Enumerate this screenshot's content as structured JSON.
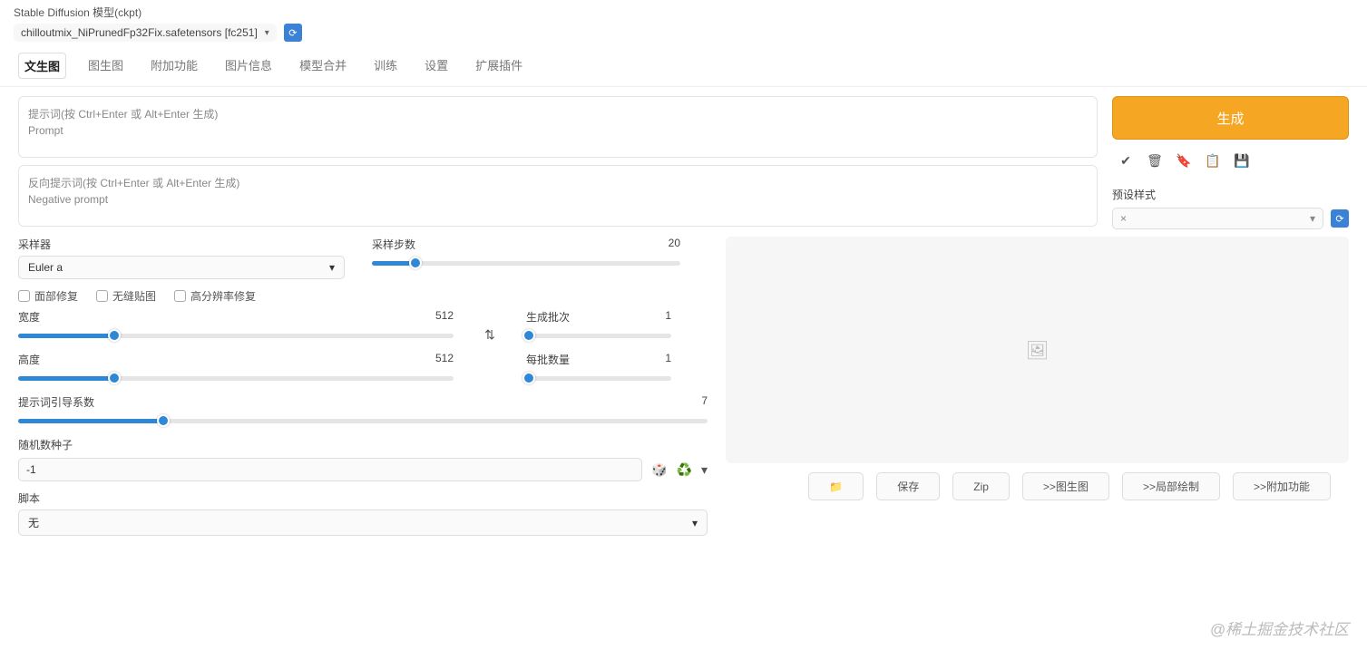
{
  "header": {
    "title": "Stable Diffusion 模型(ckpt)",
    "model": "chilloutmix_NiPrunedFp32Fix.safetensors [fc251]"
  },
  "tabs": [
    "文生图",
    "图生图",
    "附加功能",
    "图片信息",
    "模型合并",
    "训练",
    "设置",
    "扩展插件"
  ],
  "prompt": {
    "pos_placeholder": "提示词(按 Ctrl+Enter 或 Alt+Enter 生成)\nPrompt",
    "neg_placeholder": "反向提示词(按 Ctrl+Enter 或 Alt+Enter 生成)\nNegative prompt"
  },
  "gen": {
    "label": "生成"
  },
  "style": {
    "label": "预设样式",
    "placeholder": "×"
  },
  "sampler": {
    "method_label": "采样器",
    "method_value": "Euler a",
    "steps_label": "采样步数",
    "steps_value": "20"
  },
  "checks": {
    "face": "面部修复",
    "tile": "无缝贴图",
    "hires": "高分辨率修复"
  },
  "dims": {
    "width_label": "宽度",
    "width_value": "512",
    "height_label": "高度",
    "height_value": "512",
    "batch_count_label": "生成批次",
    "batch_count_value": "1",
    "batch_size_label": "每批数量",
    "batch_size_value": "1"
  },
  "cfg": {
    "label": "提示词引导系数",
    "value": "7"
  },
  "seed": {
    "label": "随机数种子",
    "value": "-1"
  },
  "script": {
    "label": "脚本",
    "value": "无"
  },
  "actions": {
    "folder": "📁",
    "save": "保存",
    "zip": "Zip",
    "img2img": ">>图生图",
    "inpaint": ">>局部绘制",
    "extras": ">>附加功能"
  },
  "watermark": "@稀土掘金技术社区"
}
